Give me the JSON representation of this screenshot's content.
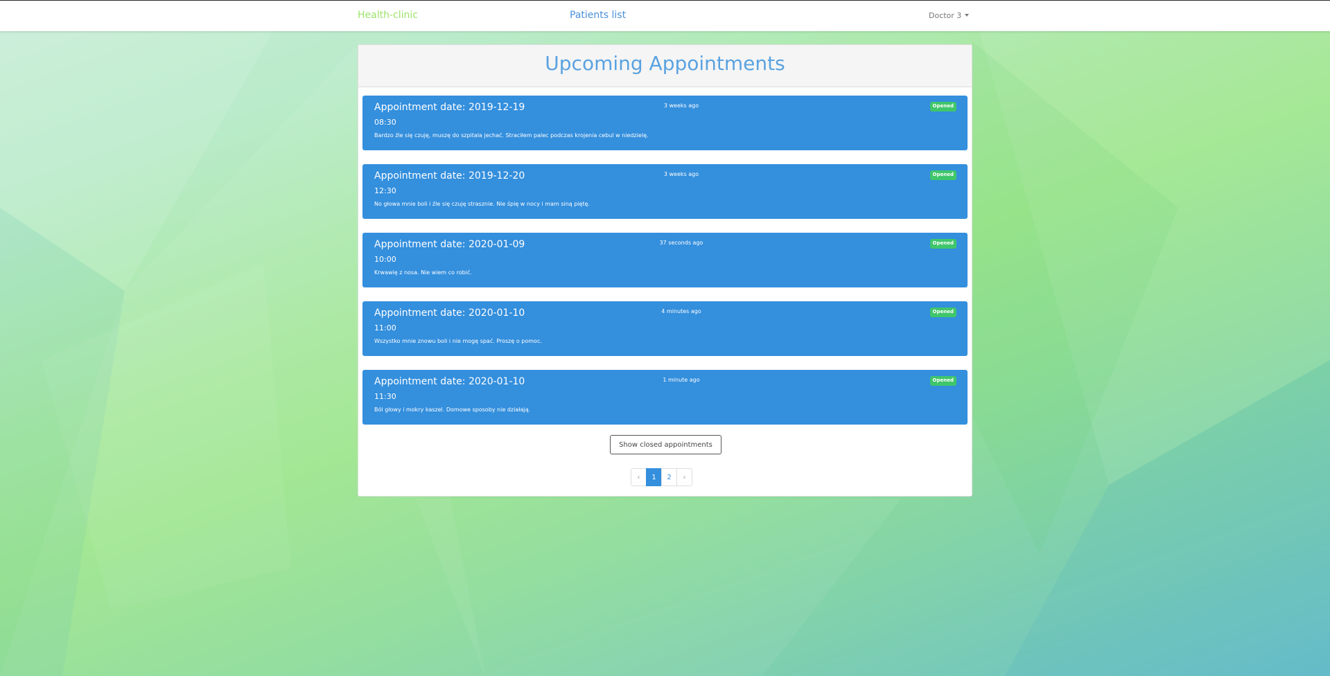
{
  "navbar": {
    "brand": "Health-clinic",
    "patients_link": "Patients list",
    "user": "Doctor 3"
  },
  "panel": {
    "title": "Upcoming Appointments"
  },
  "appointments": [
    {
      "date": "Appointment date: 2019-12-19",
      "time": "08:30",
      "ago": "3 weeks ago",
      "status": "Opened",
      "description": "Bardzo źle się czuję, muszę do szpitala jechać. Straciłem palec podczas krojenia cebul w niedzielę."
    },
    {
      "date": "Appointment date: 2019-12-20",
      "time": "12:30",
      "ago": "3 weeks ago",
      "status": "Opened",
      "description": "No głowa mnie boli i źle się czuję strasznie. Nie śpię w nocy i mam siną piętę."
    },
    {
      "date": "Appointment date: 2020-01-09",
      "time": "10:00",
      "ago": "37 seconds ago",
      "status": "Opened",
      "description": "Krwawię z nosa. Nie wiem co robić."
    },
    {
      "date": "Appointment date: 2020-01-10",
      "time": "11:00",
      "ago": "4 minutes ago",
      "status": "Opened",
      "description": "Wszystko mnie znowu boli i nie mogę spać. Proszę o pomoc."
    },
    {
      "date": "Appointment date: 2020-01-10",
      "time": "11:30",
      "ago": "1 minute ago",
      "status": "Opened",
      "description": "Ból głowy i mokry kaszel. Domowe sposoby nie działają."
    }
  ],
  "show_closed_label": "Show closed appointments",
  "pagination": {
    "prev": "‹",
    "pages": [
      "1",
      "2"
    ],
    "next": "›",
    "current": "1"
  },
  "colors": {
    "brand": "#9be36a",
    "link": "#4a90d9",
    "card": "#348fdd",
    "badge": "#3fc66a",
    "title": "#5aa2e0"
  }
}
